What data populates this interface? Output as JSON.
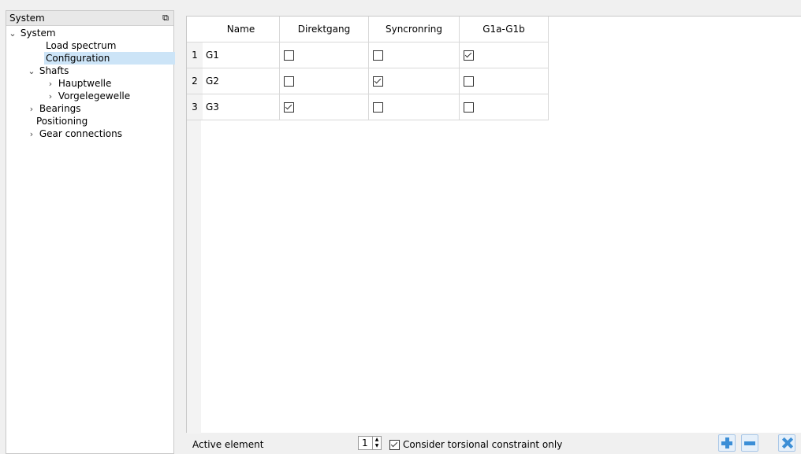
{
  "dock": {
    "title": "System",
    "float_icon": "restore-icon"
  },
  "tree": [
    {
      "label": "System",
      "expanded": true
    },
    {
      "label": "Load spectrum"
    },
    {
      "label": "Configuration",
      "selected": true
    },
    {
      "label": "Shafts",
      "expanded": true
    },
    {
      "label": "Hauptwelle",
      "expanded": false
    },
    {
      "label": "Vorgelegewelle",
      "expanded": false
    },
    {
      "label": "Bearings",
      "expanded": false
    },
    {
      "label": "Positioning"
    },
    {
      "label": "Gear connections",
      "expanded": false
    }
  ],
  "table": {
    "columns": [
      "Name",
      "Direktgang",
      "Syncronring",
      "G1a-G1b"
    ],
    "rows": [
      {
        "index": "1",
        "name": "G1",
        "checks": [
          false,
          false,
          true
        ]
      },
      {
        "index": "2",
        "name": "G2",
        "checks": [
          false,
          true,
          false
        ]
      },
      {
        "index": "3",
        "name": "G3",
        "checks": [
          true,
          false,
          false
        ]
      }
    ]
  },
  "bottom": {
    "active_label": "Active element",
    "active_value": "1",
    "consider_label": "Consider torsional constraint only",
    "consider_checked": true
  },
  "colors": {
    "accent": "#3b8ed6",
    "selection": "#cce4f7"
  }
}
